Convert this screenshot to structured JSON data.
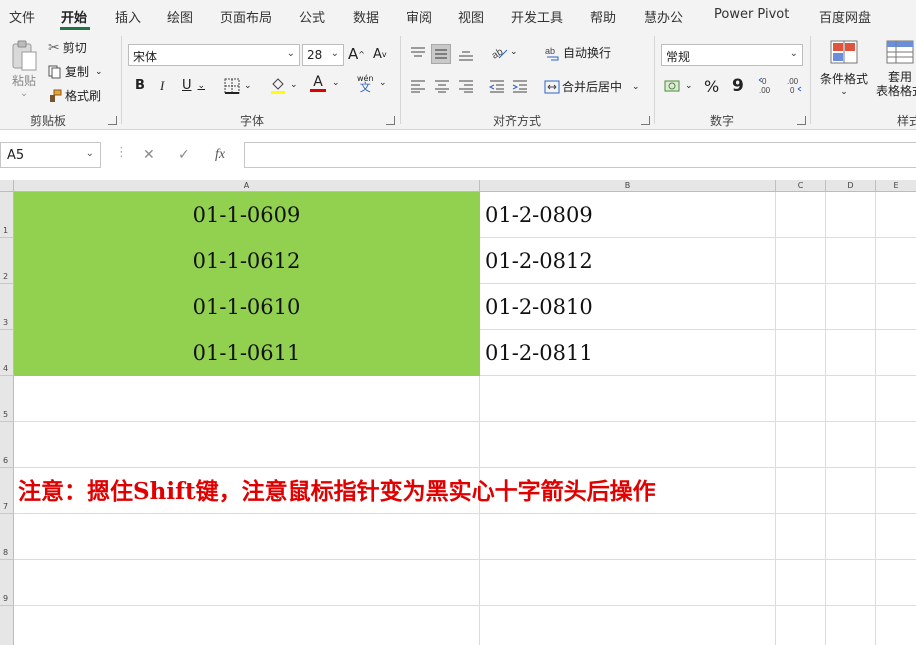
{
  "menu_tabs": [
    "文件",
    "开始",
    "插入",
    "绘图",
    "页面布局",
    "公式",
    "数据",
    "审阅",
    "视图",
    "开发工具",
    "帮助",
    "慧办公",
    "Power Pivot",
    "百度网盘"
  ],
  "active_tab": "开始",
  "ribbon": {
    "clipboard": {
      "paste": "粘贴",
      "cut": "剪切",
      "copy": "复制",
      "format_painter": "格式刷",
      "label": "剪贴板"
    },
    "font": {
      "name": "宋体",
      "size": "28",
      "label": "字体",
      "bold": "B",
      "italic": "I",
      "underline": "U",
      "grow": "A",
      "shrink": "A",
      "font_color": "A",
      "phonetic": "wén"
    },
    "alignment": {
      "wrap_text": "自动换行",
      "merge_center": "合并后居中",
      "label": "对齐方式"
    },
    "number": {
      "format": "常规",
      "percent": "%",
      "comma": "9",
      "label": "数字"
    },
    "styles": {
      "conditional": "条件格式",
      "table_format_line1": "套用",
      "table_format_line2": "表格格式",
      "label": "样式"
    }
  },
  "formula_bar": {
    "name_box": "A5",
    "cancel_glyph": "✕",
    "enter_glyph": "✓",
    "fx_glyph": "fx",
    "value": ""
  },
  "columns": [
    "A",
    "B",
    "C",
    "D",
    "E"
  ],
  "rows": [
    "1",
    "2",
    "3",
    "4",
    "5",
    "6",
    "7",
    "8",
    "9"
  ],
  "cells": {
    "A1": "01-1-0609",
    "B1": "01-2-0809",
    "A2": "01-1-0612",
    "B2": "01-2-0812",
    "A3": "01-1-0610",
    "B3": "01-2-0810",
    "A4": "01-1-0611",
    "B4": "01-2-0811"
  },
  "note": "注意：摁住Shift键，注意鼠标指针变为黑实心十字箭头后操作",
  "colors": {
    "fill_green": "#92d050",
    "note_red": "#e00000",
    "accent": "#217346"
  }
}
